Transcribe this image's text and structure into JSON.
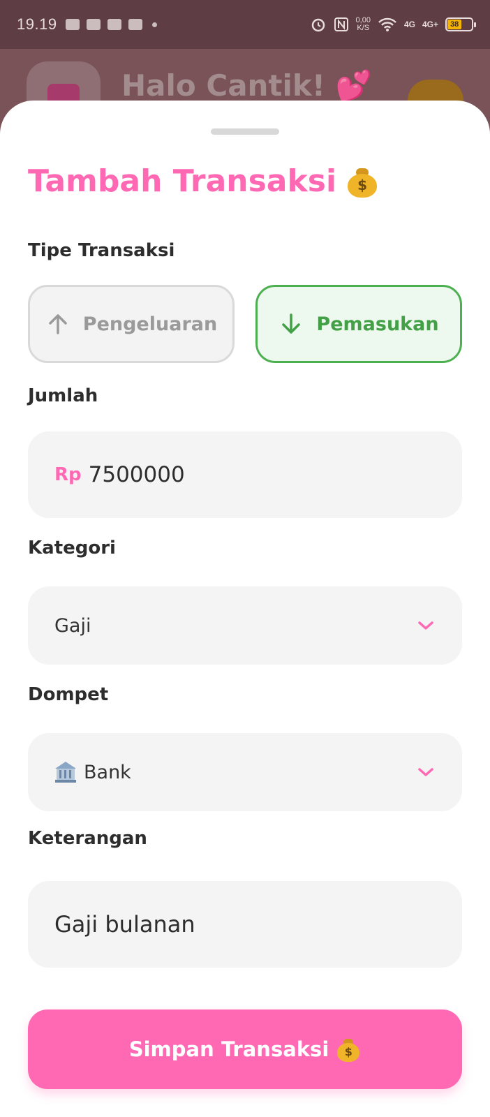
{
  "status_bar": {
    "time": "19.19",
    "net_speed_value": "0,00",
    "net_speed_unit": "K/S",
    "signal_1": "4G",
    "signal_2": "4G+",
    "battery": "38"
  },
  "background_app": {
    "greeting": "Halo Cantik! 💕"
  },
  "sheet": {
    "title": "Tambah Transaksi",
    "type_label": "Tipe Transaksi",
    "type_options": {
      "expense": "Pengeluaran",
      "income": "Pemasukan"
    },
    "selected_type": "income",
    "amount_label": "Jumlah",
    "amount_prefix": "Rp",
    "amount_value": "7500000",
    "category_label": "Kategori",
    "category_value": "Gaji",
    "wallet_label": "Dompet",
    "wallet_value": "Bank",
    "note_label": "Keterangan",
    "note_value": "Gaji bulanan",
    "save_label": "Simpan Transaksi"
  },
  "colors": {
    "accent": "#ff69b4",
    "income_green": "#4caf50",
    "field_bg": "#f4f4f4"
  },
  "icons": [
    "alarm-icon",
    "nfc-icon",
    "wifi-icon",
    "money-bag-icon",
    "arrow-up-icon",
    "arrow-down-icon",
    "chevron-down-icon",
    "bank-icon"
  ]
}
